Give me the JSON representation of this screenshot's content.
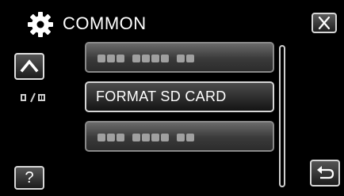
{
  "header": {
    "title": "COMMON",
    "icon": "gear-icon"
  },
  "nav": {
    "up_icon": "chevron-up-icon",
    "page_indicator_icon": "page-indicator-icon",
    "help_label": "?",
    "back_icon": "return-arrow-icon",
    "close_icon": "close-icon"
  },
  "menu": {
    "items": [
      {
        "label": "",
        "icon": "placeholder-text-icon"
      },
      {
        "label": "FORMAT SD CARD"
      },
      {
        "label": "",
        "icon": "placeholder-text-icon"
      }
    ]
  },
  "colors": {
    "background": "#000000",
    "button_border": "#d8d8d8",
    "text": "#ffffff"
  }
}
